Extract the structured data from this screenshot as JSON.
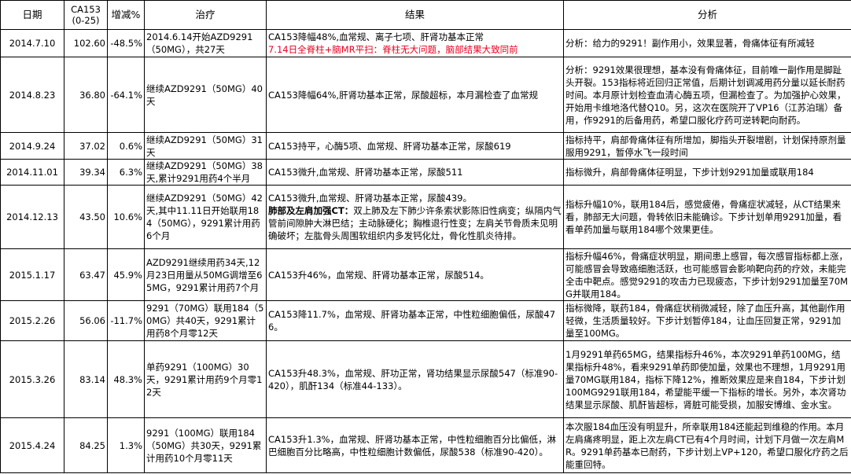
{
  "headers": {
    "date": "日期",
    "ca153_line1": "CA153",
    "ca153_line2": "(0-25)",
    "increase": "增减%",
    "treatment": "治疗",
    "result": "结果",
    "analysis": "分析"
  },
  "rows": [
    {
      "date": "2014.7.10",
      "ca153": "102.60",
      "change": "-48.5%",
      "treatment": "2014.6.14开始AZD9291（50MG），共27天",
      "result": "CA153降幅48%,血常规、离子七项、肝肾功基本正常",
      "result_red": "7.14日全脊柱+脑MR平扫：脊柱无大问题，脑部结果大致同前",
      "analysis": "分析：给力的9291！副作用小，效果显著，骨痛体征有所减轻"
    },
    {
      "date": "2014.8.23",
      "ca153": "36.80",
      "change": "-64.1%",
      "treatment": "继续AZD9291（50MG）40天",
      "result": "CA153降幅64%,肝肾功基本正常，尿酸超标，本月漏检查了血常规",
      "analysis": "分析：9291效果很理想，基本没有骨痛体征，目前唯一副作用是脚趾头开裂。153指标将近回归正常值，后期计划调减用药分量以延长耐药时间。本月原计划检查血清心酶五项，但漏检查了。为加强护心效果，开始用卡维地洛代替Q10。另，这次在医院开了VP16（江苏泊瑞）备用，作9291的后备用药，希望口服化疗药可逆转靶向耐药。"
    },
    {
      "date": "2014.9.24",
      "ca153": "37.02",
      "change": "0.6%",
      "treatment": "继续AZD9291（50MG）31天",
      "result": "CA153持平，心酶5项、血常规、肝肾功基本正常，尿酸619",
      "analysis": "指标持平，肩部骨痛体征有所增加，脚指头开裂增剧，计划保持原剂量服用9291，暂停水飞一段时间"
    },
    {
      "date": "2014.11.01",
      "ca153": "39.34",
      "change": "6.3%",
      "treatment": "继续AZD9291（50MG）38天,累计9291用药4个半月",
      "result": "CA153微升,血常规、肝肾功基本正常，尿酸511",
      "analysis": "指标微升，肩部骨痛体征明显，下步计划9291加量或联用184"
    },
    {
      "date": "2014.12.13",
      "ca153": "43.50",
      "change": "10.6%",
      "treatment": "继续AZD9291（50MG）42天,其中11.11日开始联用184（50MG），9291累计用药6个月",
      "result": "CA153微升,血常规、肝肾功基本正常，尿酸439。",
      "result_bold": "肺部及左肩加强CT：",
      "result_tail": "双上肺及左下肺少许条索状影陈旧性病变；纵隔内气管前间隙肿大淋巴结；主动脉硬化；胸椎退行性变；左肩关节骨质未见明确破坏；左肱骨头周围软组织内多发钙化灶，骨化性肌炎待排。",
      "analysis": "指标升幅10%，联用184后，感觉疲倦，骨痛症状减轻，从CT结果来看，肺部无大问题，骨转依旧未能确诊。下步计划单用9291加量，看看单药加量与联用184哪个效果更佳。"
    },
    {
      "date": "2015.1.17",
      "ca153": "63.47",
      "change": "45.9%",
      "treatment": "AZD9291继续用药34天,12月23日用量从50MG调增至65MG，9291累计用药7个月",
      "result": "CA153升46%，血常规、肝肾功基本正常，尿酸514。",
      "analysis": "指标升幅46%，骨痛症状明显，期间患上感冒，每次感冒指标都上涨，可能感冒会导致癌细胞活跃，也可能感冒会影响靶向药的疗效，未能完全击中靶点。感觉9291的攻击力已现疲态，下步计划9291加量至70MG并联用184。"
    },
    {
      "date": "2015.2.26",
      "ca153": "56.06",
      "change": "-11.7%",
      "treatment": "9291（70MG）联用184（50MG）共40天，9291累计用药8个月零12天",
      "result": "CA153降11.7%，血常规、肝肾功基本正常，中性粒细胞偏低，尿酸476。",
      "analysis": "指标微降，联药184，骨痛症状稍微减轻，除了血压升高，其他副作用轻微，生活质量较好。下步计划暂停184，让血压回复正常，9291加量至100MG。"
    },
    {
      "date": "2015.3.26",
      "ca153": "83.14",
      "change": "48.3%",
      "treatment": "单药9291（100MG）30天，9291累计用药9个月零12天",
      "result": "CA153升48.3%，血常规、肝功正常，肾功结果显示尿酸547（标准90-420），肌酐134（标准44-133）。",
      "analysis": "1月9291单药65MG，结果指标升46%，本次9291单药100MG，结果指标升48%，看来9291单药即使加量，效果也不理想，1月9291用量70MG联用184，指标下降12%，推断效果应是来自184，下步计划100MG9291联用184，希望能平缓一下指标的增长。另外，本次肾功结果显示尿酸、肌酐皆超标，肾脏可能受损，加服安博维、金水宝。"
    },
    {
      "date": "2015.4.24",
      "ca153": "84.25",
      "change": "1.3%",
      "treatment": "9291（100MG）联用184（50MG）共30天，9291累计用药10个月零11天",
      "result": "CA153升1.3%，血常规、肝肾功基本正常，中性粒细胞百分比偏低，淋巴细胞百分比略高，中性粒细胞计数偏低，尿酸538（标准90-420）。",
      "analysis": "本次服184血压没有明显升，所幸联用184还能起到维稳的作用。本月左肩痛疼明显，距上次左肩CT已有4个月时间，计划下月做一次左肩MR。9291单药基本已耐药，下步计划上VP+120，希望口服化疗药之后能重回特。"
    }
  ]
}
